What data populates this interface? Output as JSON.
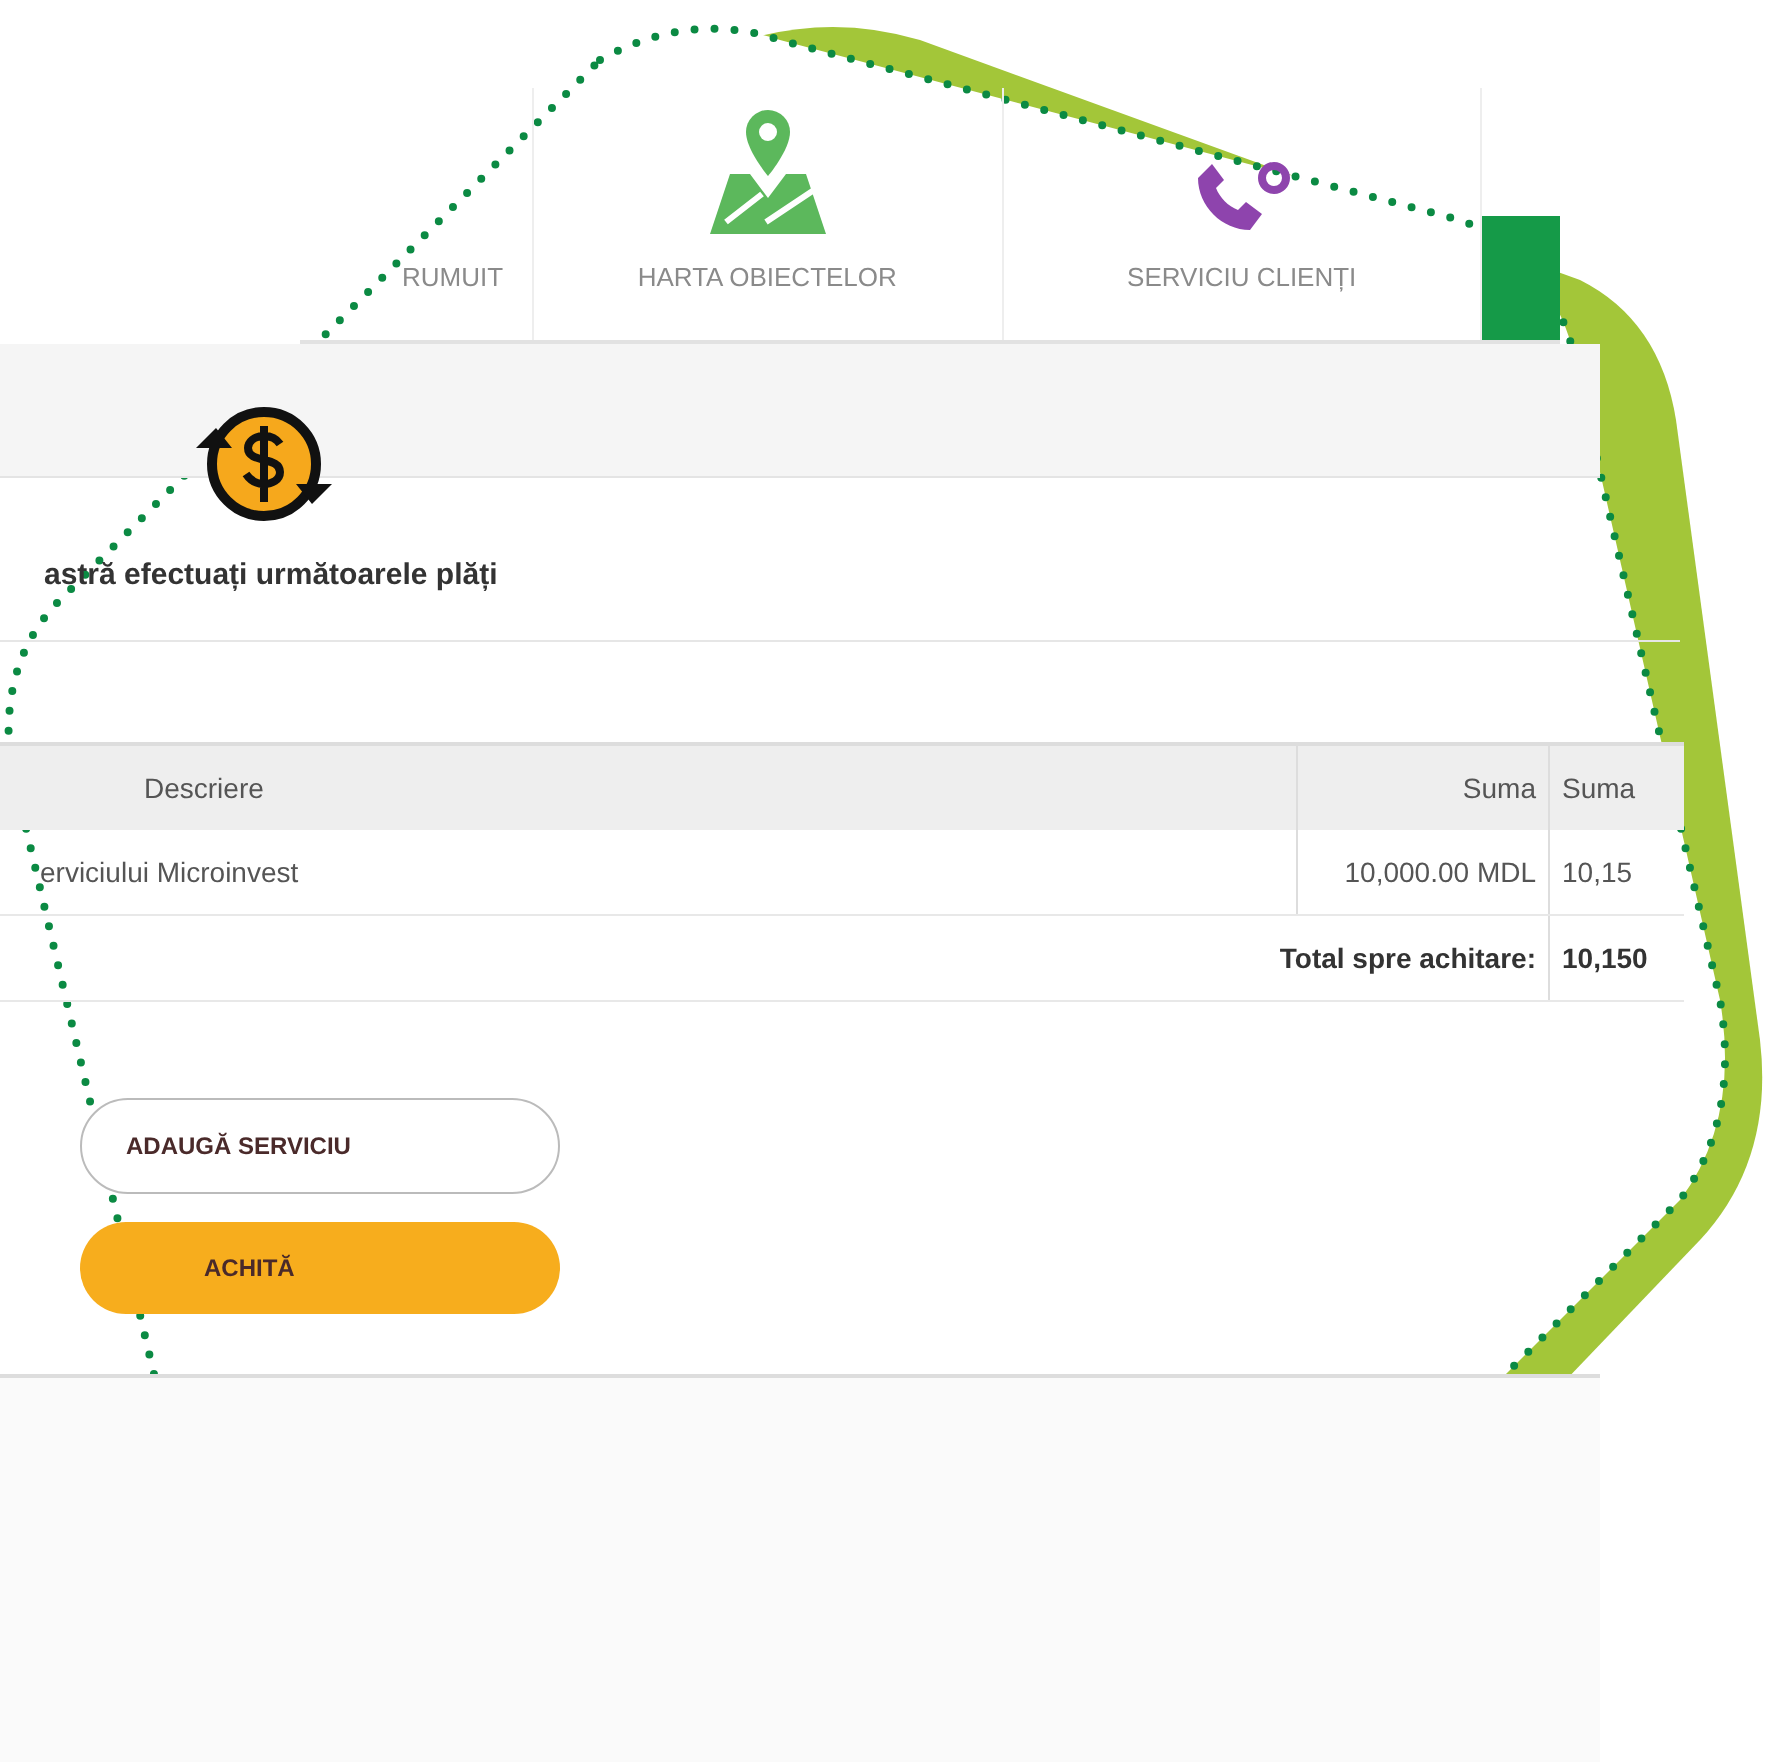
{
  "tabs": [
    {
      "label": "RUMUIT",
      "kind": "text",
      "selected": false
    },
    {
      "label": "HARTA OBIECTELOR",
      "kind": "map",
      "selected": false
    },
    {
      "label": "SERVICIU CLIENȚI",
      "kind": "phone",
      "selected": false
    },
    {
      "kind": "blank",
      "selected": true
    }
  ],
  "heading": "astră efectuați următoarele plăți",
  "table": {
    "columns": [
      "Descriere",
      "Suma",
      "Suma"
    ],
    "rows": [
      {
        "cells": [
          "erviciului Microinvest",
          "10,000.00 MDL",
          "10,15"
        ]
      }
    ],
    "total": {
      "label": "Total spre achitare:",
      "value": "10,150"
    }
  },
  "buttons": [
    {
      "label": "ADAUGĂ SERVICIU",
      "kind": "outline"
    },
    {
      "label": "ACHITĂ",
      "kind": "primary"
    }
  ]
}
